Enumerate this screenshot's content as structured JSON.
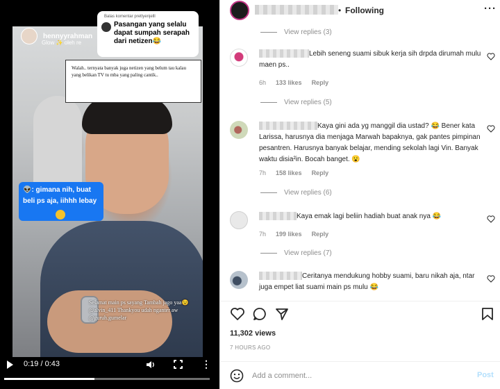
{
  "video": {
    "username": "hennyyrahman",
    "sub": "Glow ✨ oleh re",
    "reply_bubble": {
      "header": "Balas komentar prettyenjelll",
      "text": "Pasangan yang selalu dapat sumpah serapah dari netizen😂"
    },
    "caption": "Walah.. ternyata banyak juga netizen yang belum tau kalau yang belikan TV tu mba yang paling cantik..",
    "blue_bubble": "👽: gimana nih, buat beli ps aja, iihhh lebay",
    "overlay_text": "Selamat main ps sayang Tambah jago yaa😉 @alvin_411 Thankyou udah nganter aw @guruh.gumelar",
    "time": "0:19 / 0:43",
    "progress": 0.44
  },
  "header": {
    "dot": "•",
    "following": "Following",
    "more": "···"
  },
  "view_replies": [
    "View replies (3)",
    "View replies (5)",
    "View replies (6)",
    "View replies (7)"
  ],
  "comments": [
    {
      "text": "Lebih seneng suami sibuk kerja sih drpda dirumah mulu maen ps..",
      "time": "6h",
      "likes": "133 likes",
      "reply": "Reply"
    },
    {
      "text": "Kaya gini ada yg manggil dia ustad? 😂 Bener kata Larissa, harusnya dia menjaga Marwah bapaknya, gak pantes pimpinan pesantren. Harusnya banyak belajar, mending sekolah lagi Vin. Banyak waktu disia²in. Bocah banget. 😮",
      "time": "7h",
      "likes": "158 likes",
      "reply": "Reply"
    },
    {
      "text": "Kaya emak lagi beliin hadiah buat anak nya 😂",
      "time": "7h",
      "likes": "199 likes",
      "reply": "Reply"
    },
    {
      "text": "Ceritanya mendukung hobby suami, baru nikah aja, ntar juga empet liat suami main ps mulu 😂",
      "time": "",
      "likes": "",
      "reply": ""
    }
  ],
  "stats": {
    "views": "11,302 views",
    "timestamp": "7 HOURS AGO"
  },
  "input": {
    "placeholder": "Add a comment...",
    "post": "Post"
  }
}
